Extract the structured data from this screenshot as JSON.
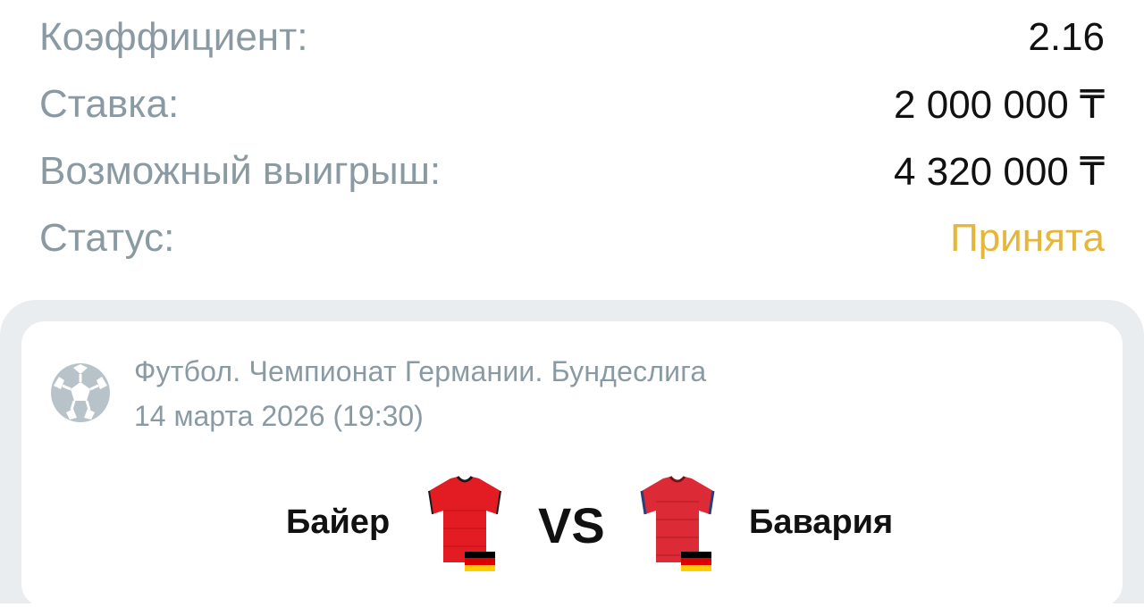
{
  "bet": {
    "coefficient_label": "Коэффициент:",
    "coefficient_value": "2.16",
    "stake_label": "Ставка:",
    "stake_value": "2 000 000 ₸",
    "payout_label": "Возможный выигрыш:",
    "payout_value": "4 320 000 ₸",
    "status_label": "Статус:",
    "status_value": "Принята"
  },
  "event": {
    "sport_icon": "soccer-ball-icon",
    "league": "Футбол. Чемпионат Германии. Бундеслига",
    "datetime": "14 марта 2026 (19:30)",
    "home_team": "Байер",
    "away_team": "Бавария",
    "vs_label": "VS",
    "home_flag": "germany-flag-icon",
    "away_flag": "germany-flag-icon"
  },
  "colors": {
    "label_gray": "#8a9aa3",
    "status_accepted": "#e5b63a",
    "panel_bg": "#eaedf0",
    "jersey_red": "#e0232a"
  }
}
